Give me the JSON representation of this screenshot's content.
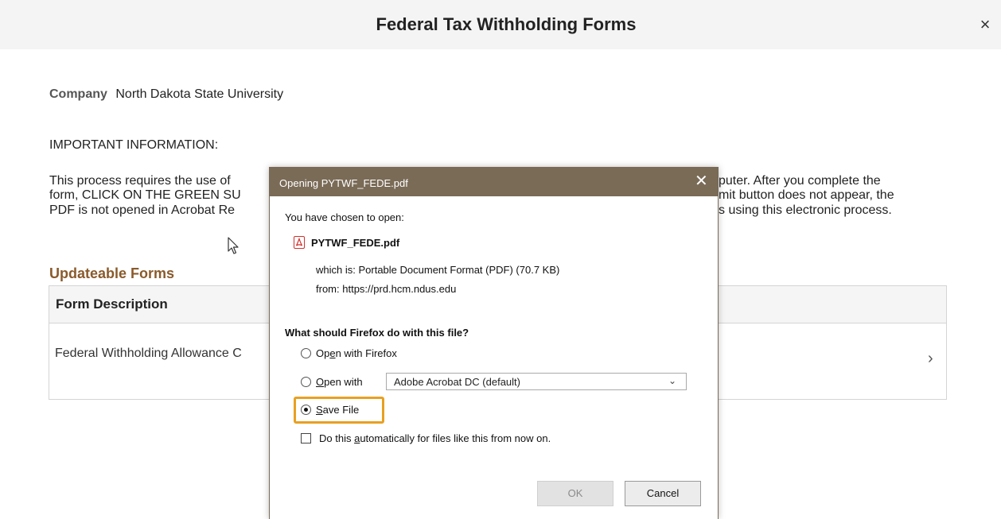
{
  "header": {
    "title": "Federal Tax Withholding Forms",
    "close_symbol": "×"
  },
  "company": {
    "label": "Company",
    "value": "North Dakota State University"
  },
  "important": {
    "heading": "IMPORTANT INFORMATION:",
    "left_lines": [
      "This process requires the use of",
      "form, CLICK ON THE GREEN SU",
      "PDF is not opened in Acrobat Re"
    ],
    "right_lines": [
      "puter.  After you complete the",
      "mit button does not appear, the",
      "s using this electronic process."
    ]
  },
  "forms_section": {
    "title": "Updateable Forms",
    "column_header": "Form Description",
    "rows": [
      {
        "description": "Federal Withholding Allowance C",
        "chevron": "›"
      }
    ]
  },
  "dialog": {
    "title": "Opening PYTWF_FEDE.pdf",
    "close_symbol": "✕",
    "chosen_label": "You have chosen to open:",
    "file_name": "PYTWF_FEDE.pdf",
    "which_is_label": "which is:",
    "which_is_value": "Portable Document Format (PDF) (70.7 KB)",
    "from_label": "from:",
    "from_value": "https://prd.hcm.ndus.edu",
    "question": "What should Firefox do with this file?",
    "options": {
      "open_with_firefox": {
        "pre": "Op",
        "accel": "e",
        "post": "n with Firefox",
        "selected": false
      },
      "open_with": {
        "pre": "",
        "accel": "O",
        "post": "pen with",
        "selected": false
      },
      "save_file": {
        "pre": "",
        "accel": "S",
        "post": "ave File",
        "selected": true
      }
    },
    "open_with_app": "Adobe Acrobat DC (default)",
    "auto_checkbox": {
      "pre": "Do this ",
      "accel": "a",
      "post": "utomatically for files like this from now on.",
      "checked": false
    },
    "ok_label": "OK",
    "cancel_label": "Cancel",
    "highlight_color": "#e8a020",
    "titlebar_color": "#7a6b57"
  },
  "colors": {
    "section_title": "#8a5a2b",
    "header_bg": "#f4f4f4"
  }
}
